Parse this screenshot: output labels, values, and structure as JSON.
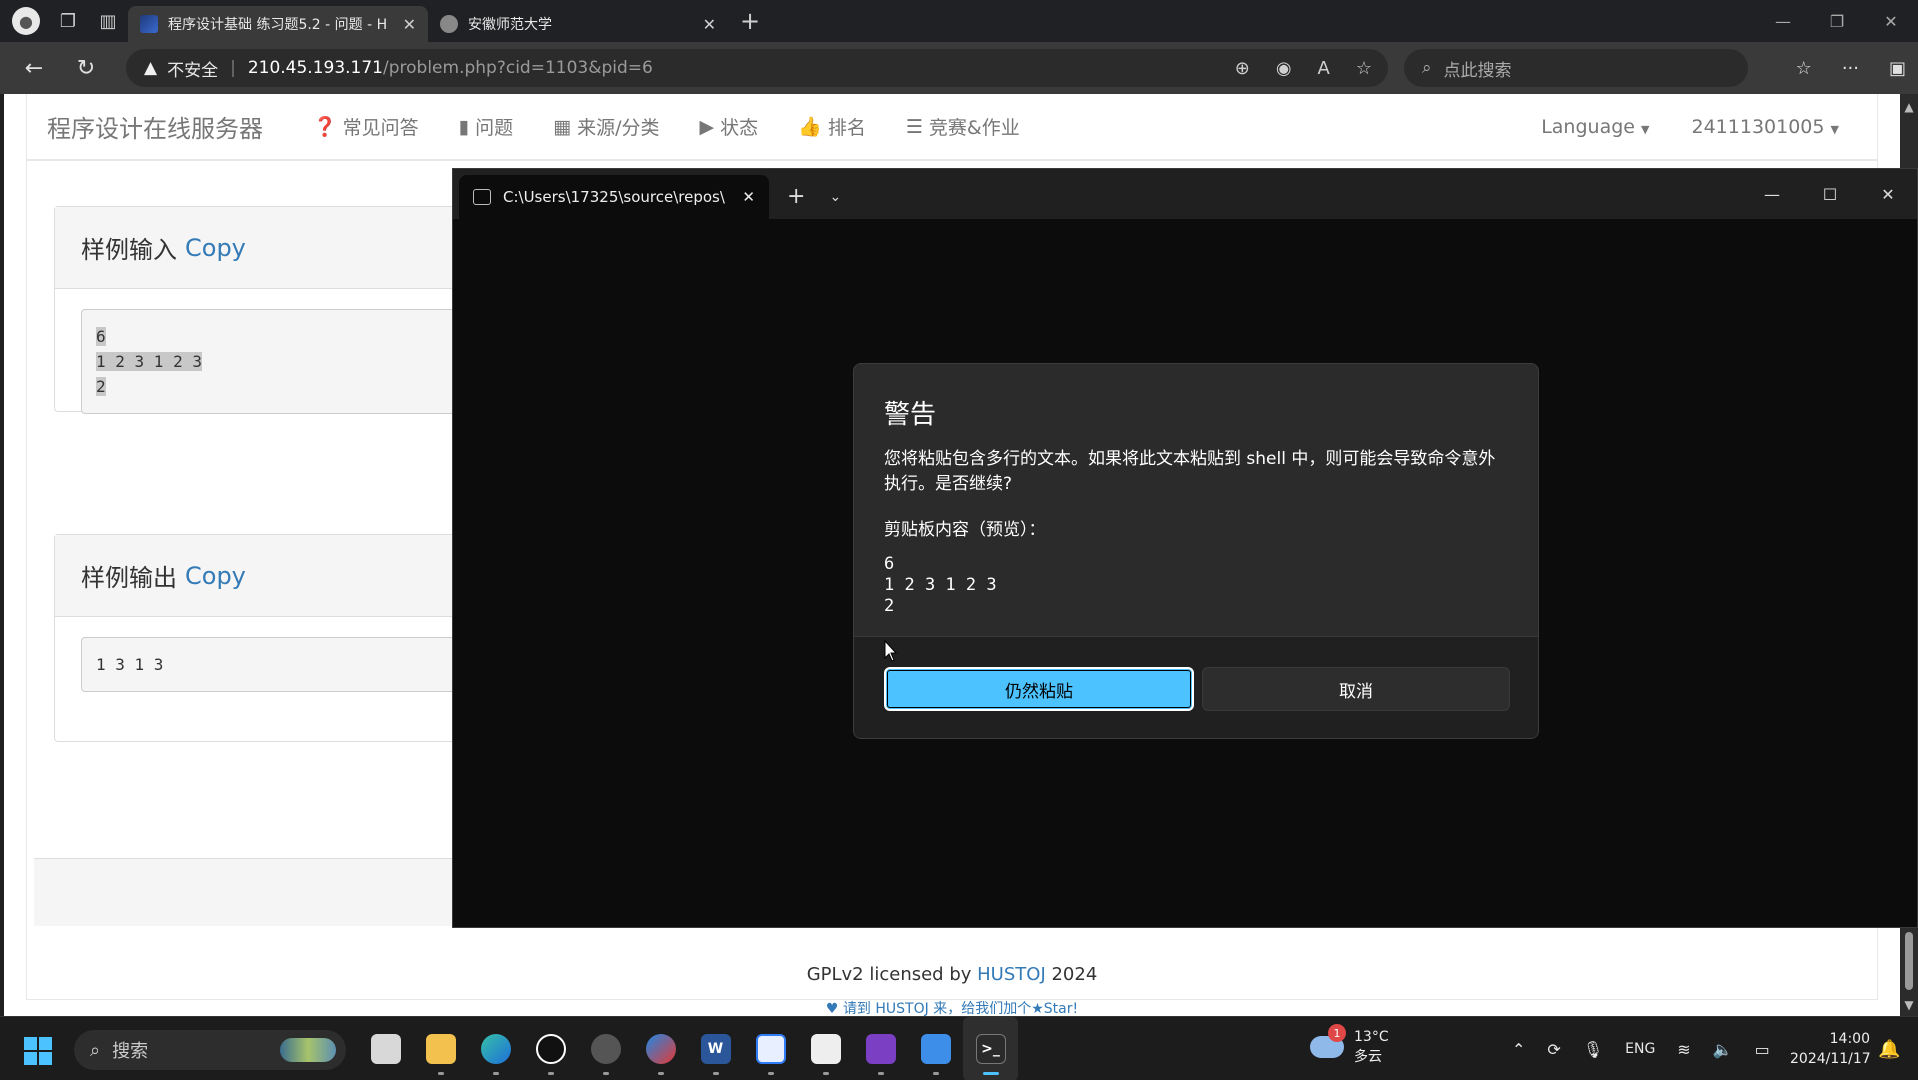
{
  "browser": {
    "tabs": [
      {
        "title": "程序设计基础 练习题5.2 - 问题 - H",
        "active": true
      },
      {
        "title": "安徽师范大学",
        "active": false
      }
    ],
    "address": {
      "security_label": "不安全",
      "host": "210.45.193.171",
      "path": "/problem.php?cid=1103&pid=6"
    },
    "search_placeholder": "点此搜索"
  },
  "site": {
    "brand": "程序设计在线服务器",
    "nav": [
      {
        "icon": "question-icon",
        "glyph": "❓",
        "label": "常见问答"
      },
      {
        "icon": "book-icon",
        "glyph": "▮",
        "label": "问题"
      },
      {
        "icon": "grid-icon",
        "glyph": "▦",
        "label": "来源/分类"
      },
      {
        "icon": "play-circle-icon",
        "glyph": "▶",
        "label": "状态"
      },
      {
        "icon": "thumbs-up-icon",
        "glyph": "👍",
        "label": "排名"
      },
      {
        "icon": "list-icon",
        "glyph": "☰",
        "label": "竞赛&作业"
      }
    ],
    "language_label": "Language",
    "user_label": "24111301005",
    "sample_input": {
      "title": "样例输入",
      "copy": "Copy",
      "lines": [
        "6",
        "1 2 3 1 2 3",
        "2"
      ]
    },
    "sample_output": {
      "title": "样例输出",
      "copy": "Copy",
      "lines": [
        "1 3 1 3"
      ]
    },
    "footer": {
      "license_prefix": "GPLv2 licensed by",
      "license_link": "HUSTOJ",
      "license_year": "2024",
      "promo": "请到 HUSTOJ 来，给我们加个★Star!"
    }
  },
  "terminal": {
    "tab_title": "C:\\Users\\17325\\source\\repos\\",
    "dialog": {
      "title": "警告",
      "message": "您将粘贴包含多行的文本。如果将此文本粘贴到 shell 中，则可能会导致命令意外执行。是否继续?",
      "preview_label": "剪贴板内容（预览）：",
      "preview_lines": [
        "6",
        "1 2 3 1 2 3",
        "2"
      ],
      "confirm_label": "仍然粘贴",
      "cancel_label": "取消"
    }
  },
  "taskbar": {
    "search_label": "搜索",
    "weather": {
      "temp": "13°C",
      "desc": "多云",
      "badge": "1"
    },
    "tray_lang": "ENG",
    "time": "14:00",
    "date": "2024/11/17"
  },
  "colors": {
    "accent": "#4cc2ff",
    "link": "#337ab7"
  }
}
